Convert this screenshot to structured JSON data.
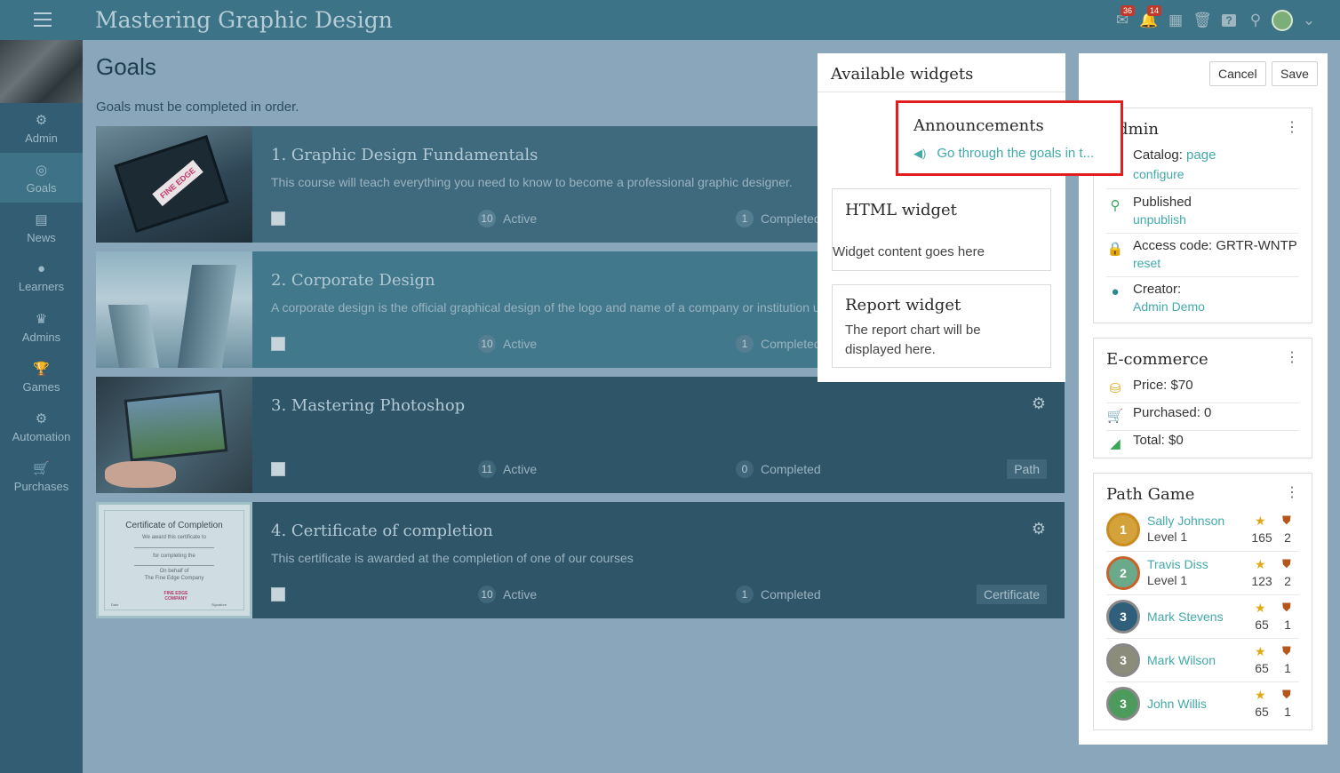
{
  "app": {
    "title": "Mastering Graphic Design"
  },
  "topbar": {
    "icons": [
      {
        "name": "messages-icon",
        "glyph": "✉",
        "badge": "36"
      },
      {
        "name": "notifications-icon",
        "glyph": "🔔",
        "badge": "14"
      },
      {
        "name": "calendar-icon",
        "glyph": "▦",
        "badge": ""
      },
      {
        "name": "trash-icon",
        "glyph": "🗑",
        "badge": ""
      },
      {
        "name": "help-icon",
        "glyph": "?",
        "badge": ""
      },
      {
        "name": "search-icon",
        "glyph": "⚲",
        "badge": ""
      }
    ],
    "menu_chevron": "⌄"
  },
  "sidebar": {
    "items": [
      {
        "name": "admin",
        "label": "Admin",
        "icon": "⚙",
        "active": false
      },
      {
        "name": "goals",
        "label": "Goals",
        "icon": "◎",
        "active": true
      },
      {
        "name": "news",
        "label": "News",
        "icon": "▤",
        "active": false
      },
      {
        "name": "learners",
        "label": "Learners",
        "icon": "●",
        "active": false
      },
      {
        "name": "admins",
        "label": "Admins",
        "icon": "♛",
        "active": false
      },
      {
        "name": "games",
        "label": "Games",
        "icon": "🏆",
        "active": false
      },
      {
        "name": "automation",
        "label": "Automation",
        "icon": "⚙",
        "active": false
      },
      {
        "name": "purchases",
        "label": "Purchases",
        "icon": "🛒",
        "active": false
      }
    ]
  },
  "main": {
    "title": "Goals",
    "subtitle": "Goals must be completed in order.",
    "courses": [
      {
        "title": "1. Graphic Design Fundamentals",
        "description": "This course will teach everything you need to know to become a professional graphic designer.",
        "active_count": "10",
        "active_label": "Active",
        "completed_count": "1",
        "completed_label": "Completed",
        "tag": ""
      },
      {
        "title": "2. Corporate Design",
        "description": "A corporate design is the official graphical design of the logo and name of a company or institution us",
        "active_count": "10",
        "active_label": "Active",
        "completed_count": "1",
        "completed_label": "Completed",
        "tag": ""
      },
      {
        "title": "3. Mastering Photoshop",
        "description": "",
        "active_count": "11",
        "active_label": "Active",
        "completed_count": "0",
        "completed_label": "Completed",
        "tag": "Path"
      },
      {
        "title": "4. Certificate of completion",
        "description": "This certificate is awarded at the completion of one of our courses",
        "active_count": "10",
        "active_label": "Active",
        "completed_count": "1",
        "completed_label": "Completed",
        "tag": "Certificate"
      }
    ],
    "certificate_thumb": {
      "heading": "Certificate of Completion",
      "line1": "We award this certificate to",
      "line2": "for completing the",
      "line3": "On behalf of",
      "line4": "The Fine Edge Company",
      "logo": "FINE EDGE COMPANY",
      "sig1": "Date",
      "sig2": "Signature"
    },
    "tablet_thumb": {
      "text": "FINE EDGE"
    }
  },
  "widgets_panel": {
    "title": "Available widgets",
    "announcements": {
      "title": "Announcements",
      "link": "Go through the goals in t..."
    },
    "html_widget": {
      "title": "HTML widget",
      "body": "Widget content goes here"
    },
    "report_widget": {
      "title": "Report widget",
      "body": "The report chart will be displayed here."
    }
  },
  "right": {
    "cancel_label": "Cancel",
    "save_label": "Save",
    "admin_box": {
      "title": "Admin",
      "catalog_label": "Catalog:",
      "catalog_link": "page",
      "catalog_configure": "configure",
      "published_label": "Published",
      "published_link": "unpublish",
      "access_label": "Access code: GRTR-WNTP",
      "access_link": "reset",
      "creator_label": "Creator:",
      "creator_link": "Admin Demo"
    },
    "ecommerce_box": {
      "title": "E-commerce",
      "price": "Price: $70",
      "purchased": "Purchased: 0",
      "total": "Total: $0"
    },
    "path_game": {
      "title": "Path Game",
      "players": [
        {
          "rank": "1",
          "name": "Sally Johnson",
          "level": "Level 1",
          "points": "165",
          "badges": "2",
          "color": "#d4a23a"
        },
        {
          "rank": "2",
          "name": "Travis Diss",
          "level": "Level 1",
          "points": "123",
          "badges": "2",
          "color": "#6aa98a"
        },
        {
          "rank": "3",
          "name": "Mark Stevens",
          "level": "",
          "points": "65",
          "badges": "1",
          "color": "#2f5f7a"
        },
        {
          "rank": "3",
          "name": "Mark Wilson",
          "level": "",
          "points": "65",
          "badges": "1",
          "color": "#8c8c7a"
        },
        {
          "rank": "3",
          "name": "John Willis",
          "level": "",
          "points": "65",
          "badges": "1",
          "color": "#4d9a5d"
        }
      ]
    }
  }
}
